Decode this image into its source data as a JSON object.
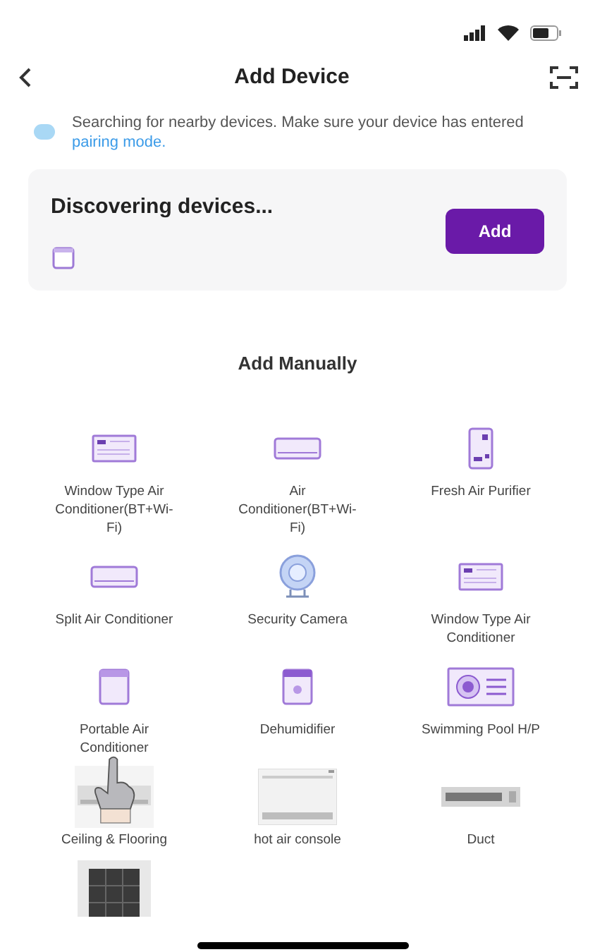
{
  "header": {
    "title": "Add Device"
  },
  "notice": {
    "text": "Searching for nearby devices. Make sure your device has entered ",
    "link": "pairing mode."
  },
  "discovery": {
    "title": "Discovering devices...",
    "button": "Add"
  },
  "section_title": "Add Manually",
  "devices": [
    {
      "kind": "window_ac",
      "label": "Window Type Air Conditioner(BT+Wi-Fi)"
    },
    {
      "kind": "split_ac",
      "label": "Air Conditioner(BT+Wi-Fi)"
    },
    {
      "kind": "purifier",
      "label": "Fresh Air Purifier"
    },
    {
      "kind": "split_ac",
      "label": "Split Air Conditioner"
    },
    {
      "kind": "camera",
      "label": "Security Camera"
    },
    {
      "kind": "window_ac",
      "label": "Window Type Air Conditioner"
    },
    {
      "kind": "portable",
      "label": "Portable Air Conditioner"
    },
    {
      "kind": "dehumidifier",
      "label": "Dehumidifier"
    },
    {
      "kind": "pool",
      "label": "Swimming Pool H/P"
    },
    {
      "kind": "picture",
      "label": "Ceiling & Flooring"
    },
    {
      "kind": "picture",
      "label": "hot air console"
    },
    {
      "kind": "picture",
      "label": "Duct"
    },
    {
      "kind": "picture"
    }
  ]
}
